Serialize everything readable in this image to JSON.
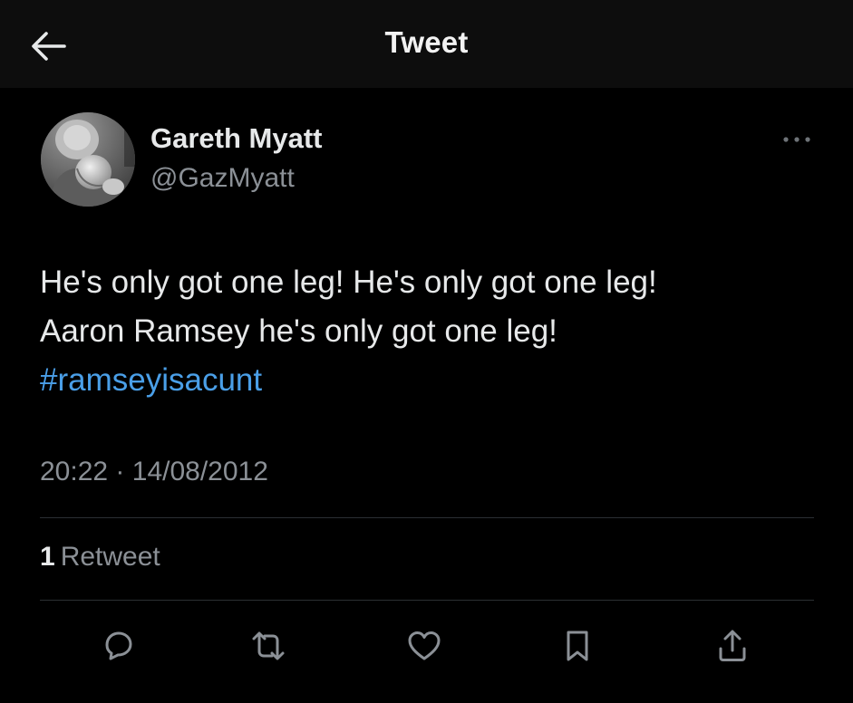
{
  "header": {
    "title": "Tweet",
    "back_icon": "arrow-left-icon"
  },
  "tweet": {
    "author": {
      "display_name": "Gareth Myatt",
      "handle": "@GazMyatt"
    },
    "text_lines": [
      "He's only got one leg! He's only got one leg!",
      "Aaron Ramsey he's only got one leg!"
    ],
    "hashtag": "#ramseyisacunt",
    "time": "20:22",
    "separator": "·",
    "date": "14/08/2012",
    "retweets": {
      "count": "1",
      "label": "Retweet"
    }
  },
  "actions": [
    {
      "name": "reply",
      "icon": "reply-bubble-icon"
    },
    {
      "name": "retweet",
      "icon": "retweet-icon"
    },
    {
      "name": "like",
      "icon": "heart-icon"
    },
    {
      "name": "bookmark",
      "icon": "bookmark-icon"
    },
    {
      "name": "share",
      "icon": "share-icon"
    }
  ],
  "colors": {
    "background": "#000000",
    "header_background": "#0d0d0d",
    "text": "#e7e9ea",
    "secondary_text": "#8b9096",
    "hashtag": "#4a9fe8",
    "divider": "#2b2f33"
  }
}
